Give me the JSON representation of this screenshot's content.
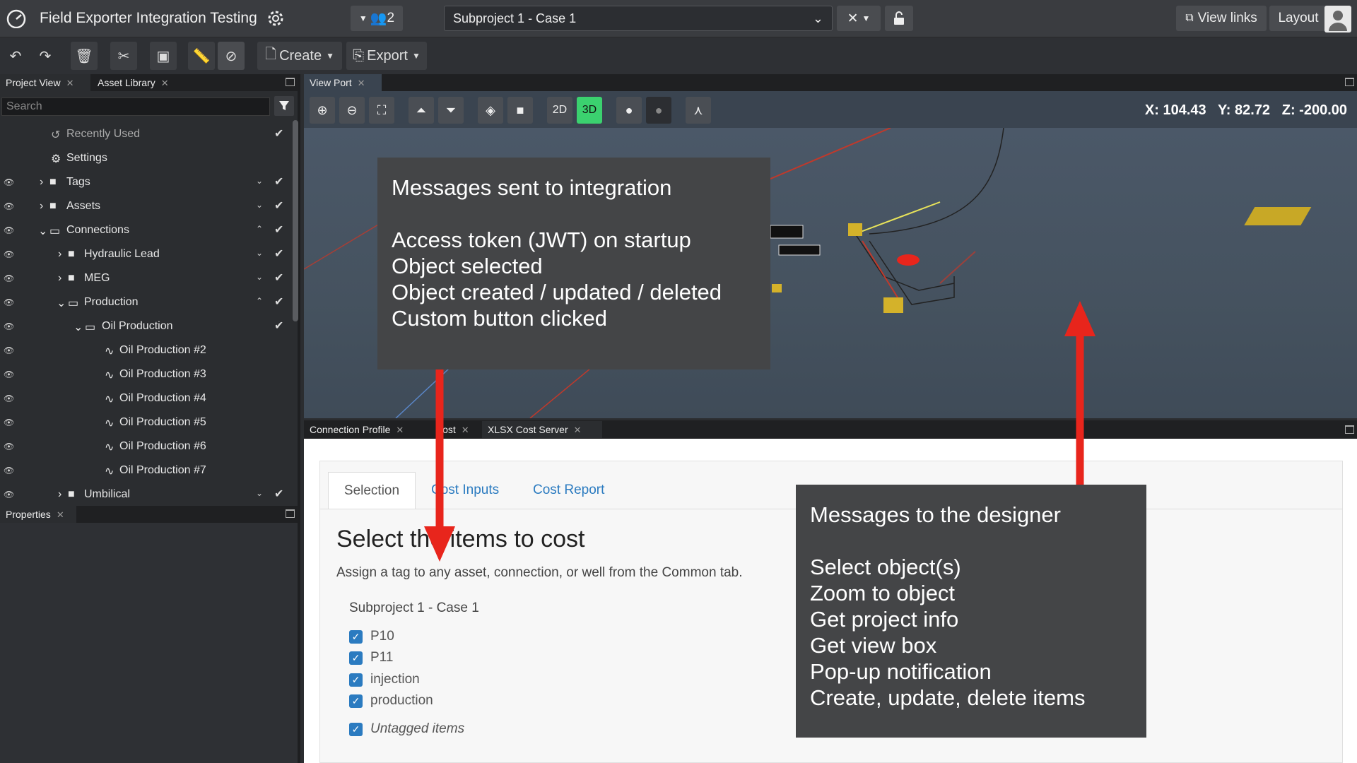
{
  "header": {
    "app_title": "Field Exporter Integration Testing",
    "users_count": "2",
    "project": "Subproject 1 - Case 1",
    "view_links": "View links",
    "layout": "Layout"
  },
  "toolbar": {
    "create": "Create",
    "export": "Export"
  },
  "left_panel": {
    "tabs": [
      "Project View",
      "Asset Library"
    ],
    "search_placeholder": "Search",
    "tree": [
      {
        "label": "Recently Used"
      },
      {
        "label": "Settings"
      },
      {
        "label": "Tags"
      },
      {
        "label": "Assets"
      },
      {
        "label": "Connections"
      },
      {
        "label": "Hydraulic Lead"
      },
      {
        "label": "MEG"
      },
      {
        "label": "Production"
      },
      {
        "label": "Oil Production"
      },
      {
        "label": "Oil Production #2"
      },
      {
        "label": "Oil Production #3"
      },
      {
        "label": "Oil Production #4"
      },
      {
        "label": "Oil Production #5"
      },
      {
        "label": "Oil Production #6"
      },
      {
        "label": "Oil Production #7"
      },
      {
        "label": "Umbilical"
      }
    ],
    "properties_tab": "Properties"
  },
  "viewport": {
    "tab": "View Port",
    "mode_2d": "2D",
    "mode_3d": "3D",
    "coords": {
      "x": "X: 104.43",
      "y": "Y: 82.72",
      "z": "Z: -200.00"
    }
  },
  "bottom_panel": {
    "tabs": [
      "Connection Profile",
      "Cost",
      "XLSX Cost Server"
    ],
    "cost_tabs": [
      "Selection",
      "Cost Inputs",
      "Cost Report"
    ],
    "title": "Select the items to cost",
    "subtitle": "Assign a tag to any asset, connection, or well from the Common tab.",
    "case": "Subproject 1 - Case 1",
    "items": [
      "P10",
      "P11",
      "injection",
      "production"
    ],
    "untagged": "Untagged items"
  },
  "overlays": {
    "integration": {
      "heading": "Messages sent to integration",
      "lines": [
        "Access token (JWT) on startup",
        "Object selected",
        "Object created / updated / deleted",
        "Custom button clicked"
      ]
    },
    "designer": {
      "heading": "Messages to the designer",
      "lines": [
        "Select object(s)",
        "Zoom to object",
        "Get project info",
        "Get view box",
        "Pop-up notification",
        "Create, update, delete items"
      ]
    }
  },
  "colors": {
    "accent_green": "#3bd16f",
    "link_blue": "#2b7bc0",
    "arrow_red": "#e8251c"
  }
}
